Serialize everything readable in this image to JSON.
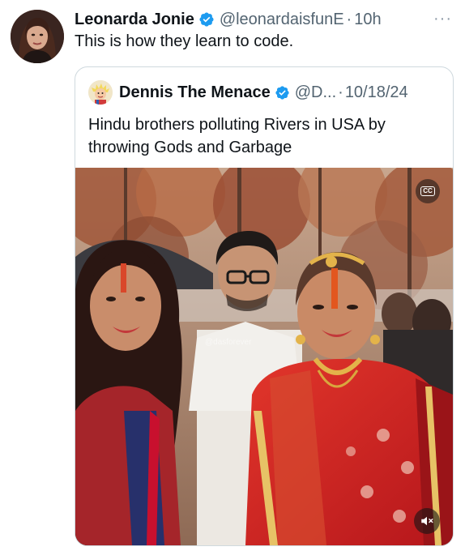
{
  "tweet": {
    "author_name": "Leonarda Jonie",
    "handle": "@leonardaisfunE",
    "separator": "·",
    "time": "10h",
    "more_label": "···",
    "text": "This is how they learn to code."
  },
  "quote": {
    "author_name": "Dennis The Menace",
    "handle": "@D...",
    "separator": "·",
    "date": "10/18/24",
    "text": "Hindu brothers polluting Rivers in USA by throwing Gods and Garbage"
  },
  "media": {
    "cc_label": "CC",
    "watermark": "@dasforever"
  },
  "colors": {
    "verified_blue": "#1d9bf0",
    "secondary_text": "#536471",
    "border": "#cfd9de"
  },
  "icons": {
    "verified": "verified-badge-icon",
    "more": "more-icon",
    "cc": "closed-captions-icon",
    "mute": "muted-speaker-icon"
  }
}
